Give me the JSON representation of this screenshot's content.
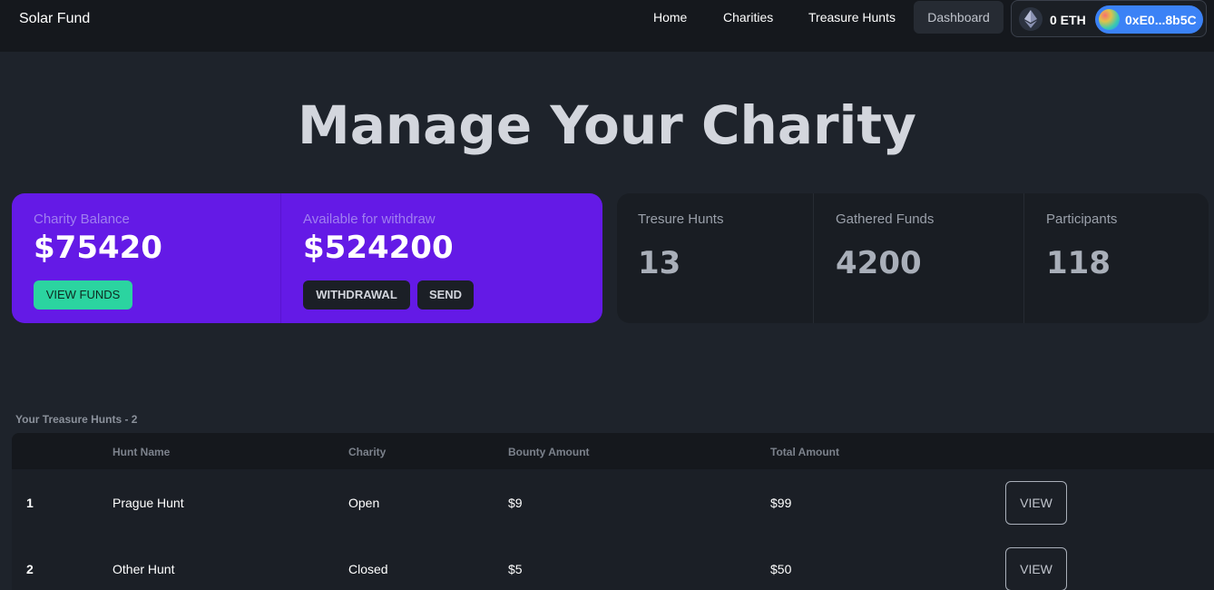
{
  "nav": {
    "brand": "Solar Fund",
    "links": [
      "Home",
      "Charities",
      "Treasure Hunts"
    ],
    "dashboard": "Dashboard",
    "wallet": {
      "balance": "0 ETH",
      "address": "0xE0...8b5C"
    }
  },
  "page": {
    "title": "Manage Your Charity"
  },
  "balance_card": {
    "charity_balance_label": "Charity Balance",
    "charity_balance_value": "$75420",
    "view_funds": "VIEW FUNDS",
    "available_label": "Available for withdraw",
    "available_value": "$524200",
    "withdrawal": "WITHDRAWAL",
    "send": "SEND"
  },
  "stats": [
    {
      "label": "Tresure Hunts",
      "value": "13"
    },
    {
      "label": "Gathered Funds",
      "value": "4200"
    },
    {
      "label": "Participants",
      "value": "118"
    }
  ],
  "hunts": {
    "section_label": "Your Treasure Hunts - 2",
    "columns": [
      "Hunt Name",
      "Charity",
      "Bounty Amount",
      "Total Amount"
    ],
    "rows": [
      {
        "index": "1",
        "name": "Prague Hunt",
        "charity": "Open",
        "bounty": "$9",
        "total": "$99",
        "action": "VIEW"
      },
      {
        "index": "2",
        "name": "Other Hunt",
        "charity": "Closed",
        "bounty": "$5",
        "total": "$50",
        "action": "VIEW"
      }
    ]
  },
  "colors": {
    "accent_purple": "#641ae6",
    "accent_green": "#2bd4a0",
    "wallet_blue": "#3b82f6",
    "background": "#1e232b"
  }
}
